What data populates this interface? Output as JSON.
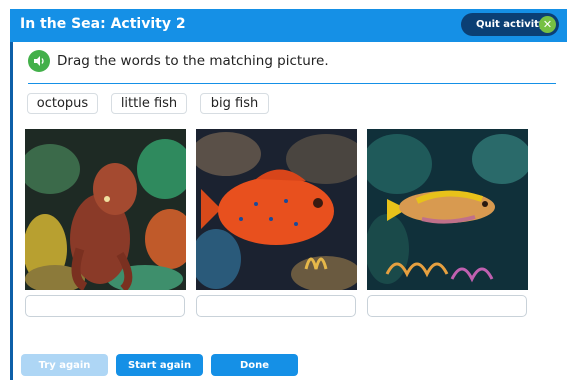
{
  "header": {
    "title": "In the Sea: Activity 2",
    "quit_label": "Quit activity",
    "quit_icon": "close-icon"
  },
  "instruction": {
    "text": "Drag the words to the matching picture.",
    "icon": "speaker-icon"
  },
  "words": [
    "octopus",
    "little fish",
    "big fish"
  ],
  "pictures": [
    {
      "depicts": "octopus-on-coral-reef"
    },
    {
      "depicts": "red-spotted-grouper-fish"
    },
    {
      "depicts": "yellow-and-pink-snapper-fish"
    }
  ],
  "answers": [
    "",
    "",
    ""
  ],
  "footer": {
    "try_again": "Try again",
    "start_again": "Start again",
    "done": "Done"
  },
  "colors": {
    "header_blue": "#1590e6",
    "quit_dark": "#0b3f74",
    "close_green": "#76c043",
    "disabled_blue": "#aed6f5"
  }
}
